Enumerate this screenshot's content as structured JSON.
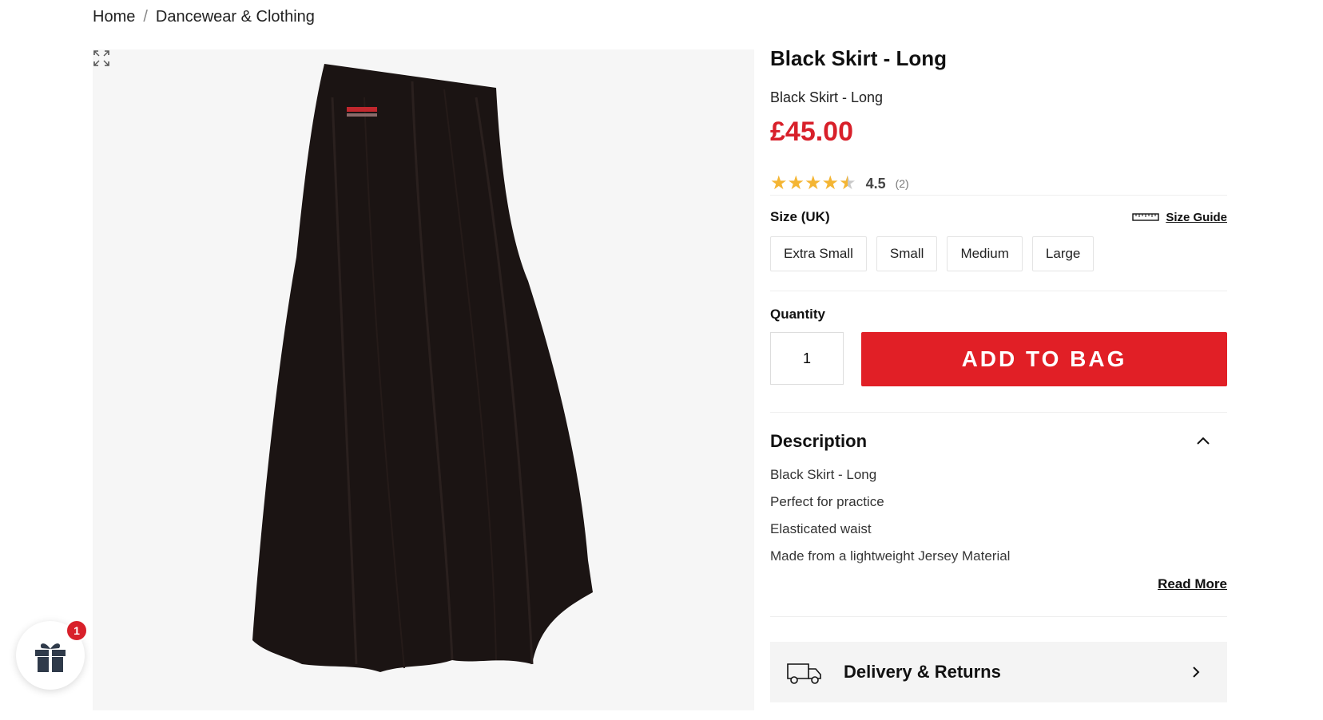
{
  "breadcrumb": {
    "home": "Home",
    "separator": "/",
    "category": "Dancewear & Clothing"
  },
  "product": {
    "title": "Black Skirt - Long",
    "subtitle": "Black Skirt - Long",
    "price": "£45.00",
    "rating": {
      "value": "4.5",
      "count": "(2)",
      "stars": 4.5
    },
    "image_alt": "Black long jersey skirt",
    "colors": {
      "price": "#d8202a",
      "add_button": "#e11f26",
      "star": "#f4b533"
    }
  },
  "size": {
    "label": "Size (UK)",
    "guide_label": "Size Guide",
    "options": [
      "Extra Small",
      "Small",
      "Medium",
      "Large"
    ]
  },
  "quantity": {
    "label": "Quantity",
    "value": "1"
  },
  "add_to_bag": "ADD TO BAG",
  "description": {
    "title": "Description",
    "lines": [
      "Black Skirt - Long",
      "Perfect for practice",
      "Elasticated waist",
      "Made from a lightweight Jersey Material"
    ],
    "read_more": "Read More"
  },
  "delivery": {
    "label": "Delivery & Returns"
  },
  "gift_widget": {
    "badge": "1"
  },
  "icons": [
    "expand-icon",
    "ruler-icon",
    "chevron-up-icon",
    "truck-icon",
    "chevron-right-icon",
    "gift-icon",
    "star-icon"
  ]
}
